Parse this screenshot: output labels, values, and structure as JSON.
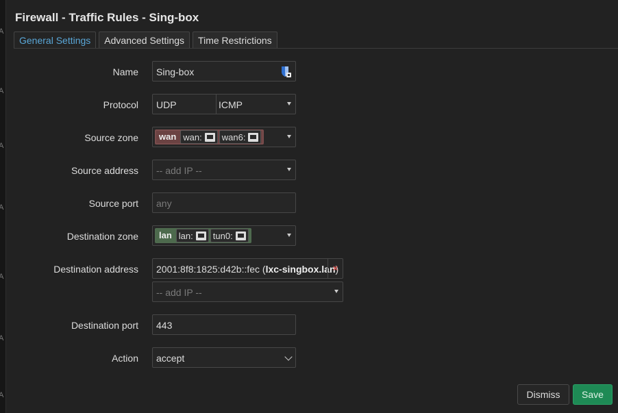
{
  "dialog": {
    "title": "Firewall - Traffic Rules - Sing-box"
  },
  "tabs": [
    {
      "label": "General Settings",
      "active": true
    },
    {
      "label": "Advanced Settings",
      "active": false
    },
    {
      "label": "Time Restrictions",
      "active": false
    }
  ],
  "form": {
    "name": {
      "label": "Name",
      "value": "Sing-box"
    },
    "protocol": {
      "label": "Protocol",
      "values": [
        "UDP",
        "ICMP"
      ]
    },
    "source_zone": {
      "label": "Source zone",
      "zone": "wan",
      "interfaces": [
        "wan:",
        "wan6:"
      ],
      "color": "#6b4242"
    },
    "source_address": {
      "label": "Source address",
      "placeholder": "-- add IP --"
    },
    "source_port": {
      "label": "Source port",
      "placeholder": "any"
    },
    "destination_zone": {
      "label": "Destination zone",
      "zone": "lan",
      "interfaces": [
        "lan:",
        "tun0:"
      ],
      "color": "#4d6a4d"
    },
    "destination_address": {
      "label": "Destination address",
      "value_ip": "2001:8f8:1825:d42b::fec",
      "value_host": "lxc-singbox.lan",
      "remove": "×",
      "add_placeholder": "-- add IP --"
    },
    "destination_port": {
      "label": "Destination port",
      "value": "443"
    },
    "action": {
      "label": "Action",
      "value": "accept"
    }
  },
  "buttons": {
    "dismiss": "Dismiss",
    "save": "Save"
  },
  "background_edge_letters": [
    "A",
    "A",
    "A",
    "A",
    "A",
    "A",
    "A"
  ],
  "colors": {
    "accent": "#5aa7d8",
    "save": "#1e8a55",
    "remove": "#d9534f"
  }
}
